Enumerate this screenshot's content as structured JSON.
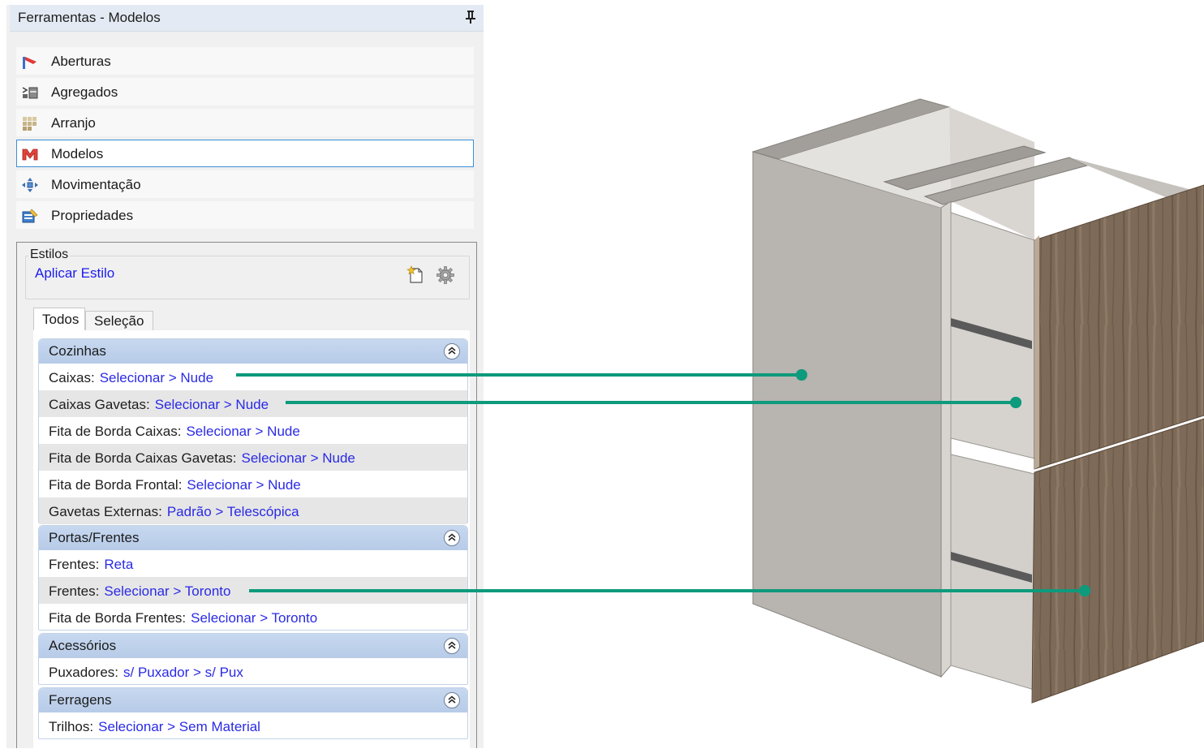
{
  "panel": {
    "title": "Ferramentas - Modelos",
    "nav_items": [
      {
        "label": "Aberturas",
        "icon": "aberturas-icon"
      },
      {
        "label": "Agregados",
        "icon": "agregados-icon"
      },
      {
        "label": "Arranjo",
        "icon": "arranjo-icon"
      },
      {
        "label": "Modelos",
        "icon": "modelos-icon",
        "selected": true
      },
      {
        "label": "Movimentação",
        "icon": "movimentacao-icon"
      },
      {
        "label": "Propriedades",
        "icon": "propriedades-icon"
      }
    ]
  },
  "estilos": {
    "legend": "Estilos",
    "apply_link": "Aplicar Estilo"
  },
  "tabs": [
    "Todos",
    "Seleção"
  ],
  "sections": [
    {
      "title": "Cozinhas",
      "rows": [
        {
          "label": "Caixas:",
          "value": "Selecionar > Nude"
        },
        {
          "label": "Caixas Gavetas:",
          "value": "Selecionar > Nude"
        },
        {
          "label": "Fita de Borda Caixas:",
          "value": "Selecionar > Nude"
        },
        {
          "label": "Fita de Borda Caixas Gavetas:",
          "value": "Selecionar > Nude"
        },
        {
          "label": "Fita de Borda Frontal:",
          "value": "Selecionar > Nude"
        },
        {
          "label": "Gavetas Externas:",
          "value": "Padrão > Telescópica"
        }
      ]
    },
    {
      "title": "Portas/Frentes",
      "rows": [
        {
          "label": "Frentes:",
          "value": "Reta"
        },
        {
          "label": "Frentes:",
          "value": "Selecionar > Toronto"
        },
        {
          "label": "Fita de Borda Frentes:",
          "value": "Selecionar > Toronto"
        }
      ]
    },
    {
      "title": "Acessórios",
      "rows": [
        {
          "label": "Puxadores:",
          "value": "s/ Puxador > s/ Pux"
        }
      ]
    },
    {
      "title": "Ferragens",
      "rows": [
        {
          "label": "Trilhos:",
          "value": "Selecionar > Sem Material"
        }
      ]
    }
  ],
  "colors": {
    "link": "#2a2ae6",
    "callout": "#0e9a7c",
    "selection_border": "#3c8fd6",
    "section_header": "#c1d4ee"
  }
}
